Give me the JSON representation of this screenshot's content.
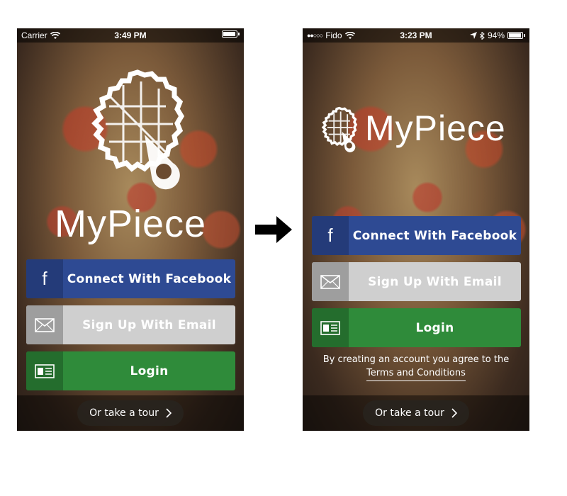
{
  "left_screen": {
    "status": {
      "carrier": "Carrier",
      "time": "3:49 PM"
    },
    "brand": "MyPiece",
    "buttons": {
      "facebook": {
        "icon_letter": "f",
        "label": "Connect With Facebook"
      },
      "email": {
        "label": "Sign Up With Email"
      },
      "login": {
        "label": "Login"
      }
    },
    "tour": {
      "label": "Or take a tour"
    }
  },
  "right_screen": {
    "status": {
      "signal": "●●○○○",
      "carrier": "Fido",
      "time": "3:23 PM",
      "battery": "94%"
    },
    "brand": "MyPiece",
    "buttons": {
      "facebook": {
        "icon_letter": "f",
        "label": "Connect With Facebook"
      },
      "email": {
        "label": "Sign Up With Email"
      },
      "login": {
        "label": "Login"
      }
    },
    "terms": {
      "text": "By creating an account you agree to the",
      "link": "Terms and Conditions"
    },
    "tour": {
      "label": "Or take a tour"
    }
  },
  "icons": {
    "wifi": "wifi-icon",
    "battery": "battery-icon",
    "location": "location-arrow-icon",
    "bluetooth": "bluetooth-icon",
    "facebook": "facebook-icon",
    "envelope": "envelope-icon",
    "id_card": "id-card-icon",
    "chevron": "chevron-right-icon",
    "arrow": "right-arrow-icon"
  },
  "colors": {
    "facebook": "#2e4a93",
    "email": "#cfcfcf",
    "login": "#2f8b3a"
  }
}
